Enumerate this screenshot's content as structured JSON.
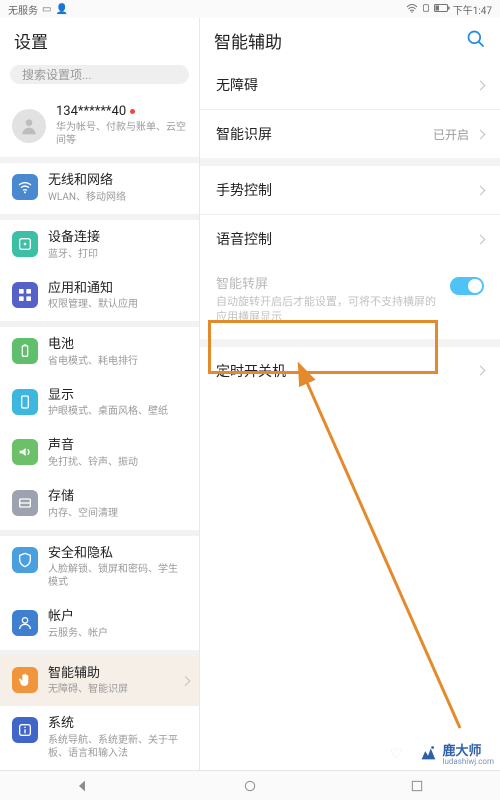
{
  "status_bar": {
    "service": "无服务",
    "time": "下午1:47"
  },
  "left": {
    "title": "设置",
    "search_placeholder": "搜索设置项...",
    "account": {
      "phone": "134******40",
      "sub": "华为帐号、付款与账单、云空间等"
    },
    "items": [
      {
        "title": "无线和网络",
        "sub": "WLAN、移动网络"
      },
      {
        "title": "设备连接",
        "sub": "蓝牙、打印"
      },
      {
        "title": "应用和通知",
        "sub": "权限管理、默认应用"
      },
      {
        "title": "电池",
        "sub": "省电模式、耗电排行"
      },
      {
        "title": "显示",
        "sub": "护眼模式、桌面风格、壁纸"
      },
      {
        "title": "声音",
        "sub": "免打扰、铃声、振动"
      },
      {
        "title": "存储",
        "sub": "内存、空间清理"
      },
      {
        "title": "安全和隐私",
        "sub": "人脸解锁、锁屏和密码、学生模式"
      },
      {
        "title": "帐户",
        "sub": "云服务、帐户"
      },
      {
        "title": "智能辅助",
        "sub": "无障碍、智能识屏"
      },
      {
        "title": "系统",
        "sub": "系统导航、系统更新、关于平板、语言和输入法"
      }
    ]
  },
  "right": {
    "title": "智能辅助",
    "items": [
      {
        "title": "无障碍",
        "value": ""
      },
      {
        "title": "智能识屏",
        "value": "已开启"
      },
      {
        "title": "手势控制",
        "value": ""
      },
      {
        "title": "语音控制",
        "value": ""
      }
    ],
    "disabled": {
      "title": "智能转屏",
      "sub": "自动旋转开启后才能设置，可将不支持横屏的应用横屏显示"
    },
    "scheduled": {
      "title": "定时开关机"
    }
  },
  "watermark": {
    "cn": "鹿大师",
    "url": "ludashiwj.com"
  }
}
